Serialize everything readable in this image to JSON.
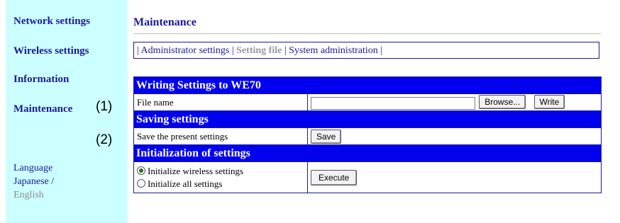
{
  "sidebar": {
    "items": [
      {
        "label": "Network settings"
      },
      {
        "label": "Wireless settings"
      },
      {
        "label": "Information"
      },
      {
        "label": "Maintenance"
      }
    ],
    "markers": [
      "(1)",
      "(2)"
    ],
    "language": {
      "label": "Language",
      "japanese": "Japanese",
      "separator": " /",
      "english": "English"
    }
  },
  "main": {
    "title": "Maintenance",
    "tabs": {
      "sep1": "| ",
      "admin": "Administrator settings",
      "sep2": " | ",
      "setting_file": "Setting file",
      "sep3": " | ",
      "system": "System administration",
      "sep4": " |"
    },
    "writing": {
      "header": "Writing Settings to WE70",
      "file_label": "File name",
      "file_value": "",
      "browse": "Browse...",
      "write": "Write"
    },
    "saving": {
      "header": "Saving settings",
      "label": "Save the present settings",
      "save": "Save"
    },
    "init": {
      "header": "Initialization of settings",
      "option1": "Initialize wireless settings",
      "option2": "Initialize all settings",
      "selected": "option1",
      "execute": "Execute"
    }
  },
  "colors": {
    "sidebar_bg": "#ccffff",
    "header_bg": "#0000ee",
    "link": "#1a1a99",
    "inactive": "#9a9a9a"
  }
}
